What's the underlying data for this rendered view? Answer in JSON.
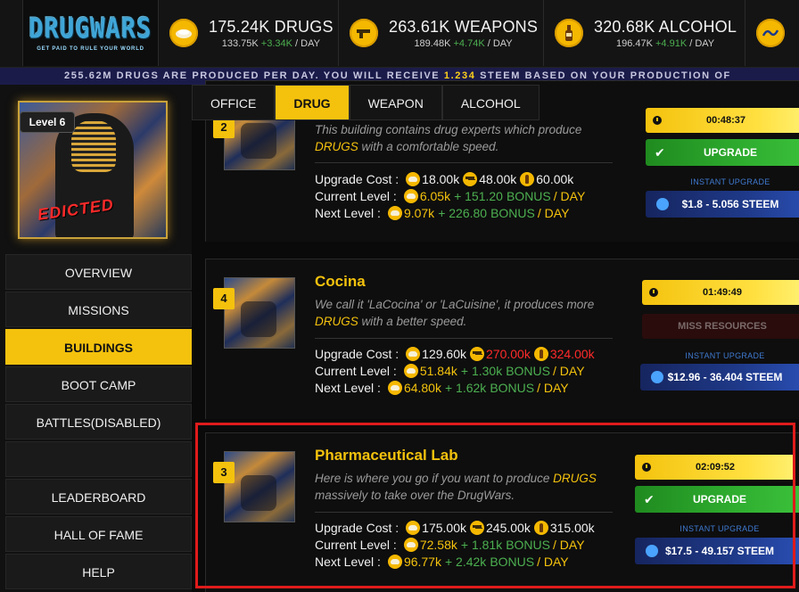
{
  "logo": {
    "title": "DRUGWARS",
    "tagline": "GET PAID TO RULE YOUR WORLD"
  },
  "resources": [
    {
      "name": "drugs",
      "total": "175.24K DRUGS",
      "base": "133.75K",
      "bonus": "+3.34K",
      "unit": "/ DAY",
      "icon": "drug-coin-icon"
    },
    {
      "name": "weapons",
      "total": "263.61K WEAPONS",
      "base": "189.48K",
      "bonus": "+4.74K",
      "unit": "/ DAY",
      "icon": "gun-coin-icon"
    },
    {
      "name": "alcohol",
      "total": "320.68K ALCOHOL",
      "base": "196.47K",
      "bonus": "+4.91K",
      "unit": "/ DAY",
      "icon": "bottle-coin-icon"
    }
  ],
  "ticker": {
    "prefix": "255.62M DRUGS ARE PRODUCED PER DAY. YOU WILL RECEIVE ",
    "amount": "1.234",
    "suffix": " STEEM BASED ON YOUR PRODUCTION OF"
  },
  "profile": {
    "level": "Level 6",
    "name_tag": "EDICTED"
  },
  "nav": [
    "OVERVIEW",
    "MISSIONS",
    "BUILDINGS",
    "BOOT CAMP",
    "BATTLES(DISABLED)",
    "",
    "LEADERBOARD",
    "HALL OF FAME",
    "HELP"
  ],
  "tabs": [
    "OFFICE",
    "DRUG",
    "WEAPON",
    "ALCOHOL"
  ],
  "labels": {
    "upgrade_cost": "Upgrade Cost :",
    "current_level": "Current Level :",
    "next_level": "Next Level :",
    "bonus": "BONUS",
    "per_day": "/ DAY",
    "instant_upgrade": "INSTANT UPGRADE",
    "upgrade": "UPGRADE",
    "miss_resources": "MISS RESOURCES"
  },
  "buildings": [
    {
      "level": "2",
      "name": "",
      "desc_pre": "This building contains drug experts which produce ",
      "desc_hl": "DRUGS",
      "desc_post": " with a comfortable speed.",
      "cost": {
        "drugs": "18.00k",
        "weapons": "48.00k",
        "alcohol": "60.00k"
      },
      "current": {
        "base": "6.05k",
        "bonus": "+ 151.20"
      },
      "next": {
        "base": "9.07k",
        "bonus": "+ 226.80"
      },
      "timer": "00:48:37",
      "steem": "$1.8 - 5.056 STEEM"
    },
    {
      "level": "4",
      "name": "Cocina",
      "desc_pre": "We call it 'LaCocina' or 'LaCuisine', it produces more ",
      "desc_hl": "DRUGS",
      "desc_post": " with a better speed.",
      "cost": {
        "drugs": "129.60k",
        "weapons": "270.00k",
        "alcohol": "324.00k"
      },
      "current": {
        "base": "51.84k",
        "bonus": "+ 1.30k"
      },
      "next": {
        "base": "64.80k",
        "bonus": "+ 1.62k"
      },
      "timer": "01:49:49",
      "steem": "$12.96 - 36.404 STEEM"
    },
    {
      "level": "3",
      "name": "Pharmaceutical Lab",
      "desc_pre": "Here is where you go if you want to produce ",
      "desc_hl": "DRUGS",
      "desc_post": " massively to take over the DrugWars.",
      "cost": {
        "drugs": "175.00k",
        "weapons": "245.00k",
        "alcohol": "315.00k"
      },
      "current": {
        "base": "72.58k",
        "bonus": "+ 1.81k"
      },
      "next": {
        "base": "96.77k",
        "bonus": "+ 2.42k"
      },
      "timer": "02:09:52",
      "steem": "$17.5 - 49.157 STEEM"
    }
  ],
  "colors": {
    "accent": "#f4c20d",
    "upgrade": "#2fae2f",
    "steem": "#1f3a8a",
    "insufficient": "#ff2a2a",
    "highlight": "#e01b1b"
  }
}
